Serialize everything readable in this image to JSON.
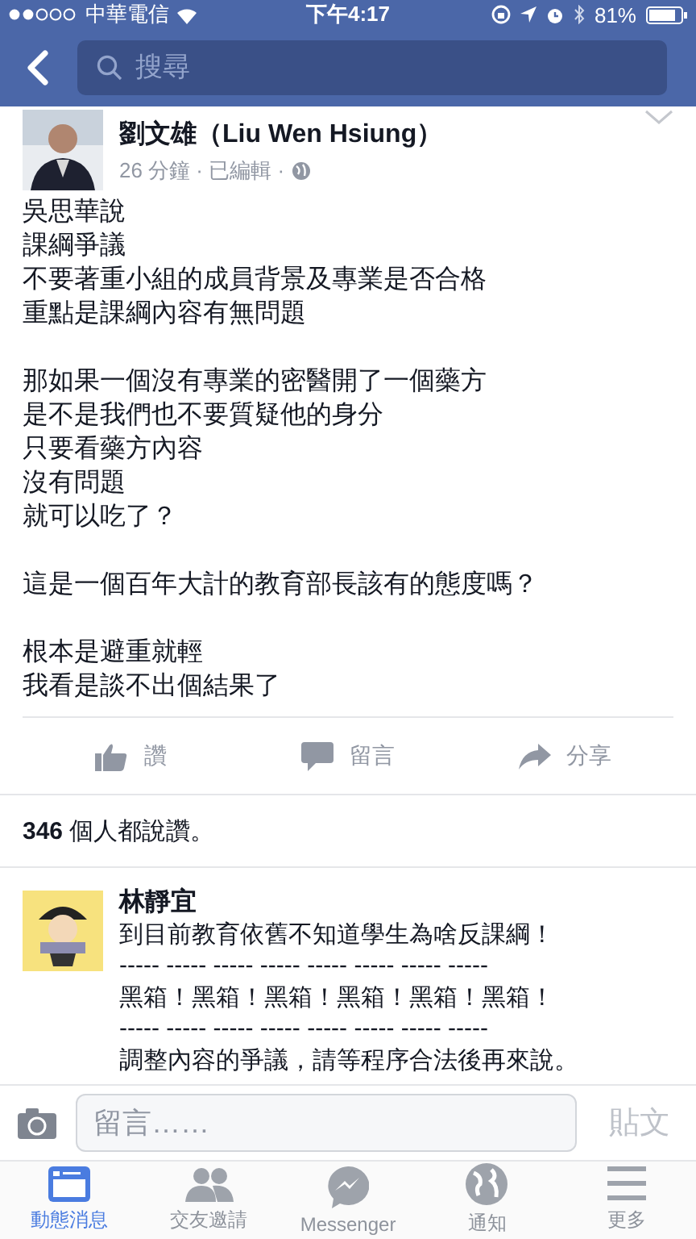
{
  "status_bar": {
    "carrier": "中華電信",
    "time": "下午4:17",
    "battery": "81%"
  },
  "nav": {
    "search": {
      "placeholder": "搜尋"
    }
  },
  "post": {
    "author": "劉文雄（Liu Wen Hsiung）",
    "meta": "26 分鐘 · 已編輯 ·",
    "paragraphs": [
      [
        "吳思華說",
        "課綱爭議",
        "不要著重小組的成員背景及專業是否合格",
        "重點是課綱內容有無問題"
      ],
      [
        "那如果一個沒有專業的密醫開了一個藥方",
        "是不是我們也不要質疑他的身分",
        "只要看藥方內容",
        "沒有問題",
        "就可以吃了？"
      ],
      [
        "這是一個百年大計的教育部長該有的態度嗎？"
      ],
      [
        "根本是避重就輕",
        "我看是談不出個結果了"
      ]
    ],
    "actions": [
      {
        "kind": "like",
        "label": "讚"
      },
      {
        "kind": "comment",
        "label": "留言"
      },
      {
        "kind": "share",
        "label": "分享"
      }
    ],
    "likes": "**346** 個人都說讚。"
  },
  "comment": {
    "author": "林靜宜",
    "lines": [
      "到目前教育依舊不知道學生為啥反課綱！",
      "----- ----- ----- ----- ----- ----- ----- -----",
      "黑箱！黑箱！黑箱！黑箱！黑箱！黑箱！",
      "----- ----- ----- ----- ----- ----- ----- -----",
      "調整內容的爭議，請等程序合法後再來說。"
    ]
  },
  "composer": {
    "placeholder": "留言……",
    "post_button": "貼文"
  },
  "tabs": [
    {
      "kind": "feed",
      "label": "動態消息",
      "selected": true
    },
    {
      "kind": "friends",
      "label": "交友邀請",
      "selected": false
    },
    {
      "kind": "messenger",
      "label": "Messenger",
      "selected": false
    },
    {
      "kind": "notifications",
      "label": "通知",
      "selected": false
    },
    {
      "kind": "more",
      "label": "更多",
      "selected": false
    }
  ]
}
